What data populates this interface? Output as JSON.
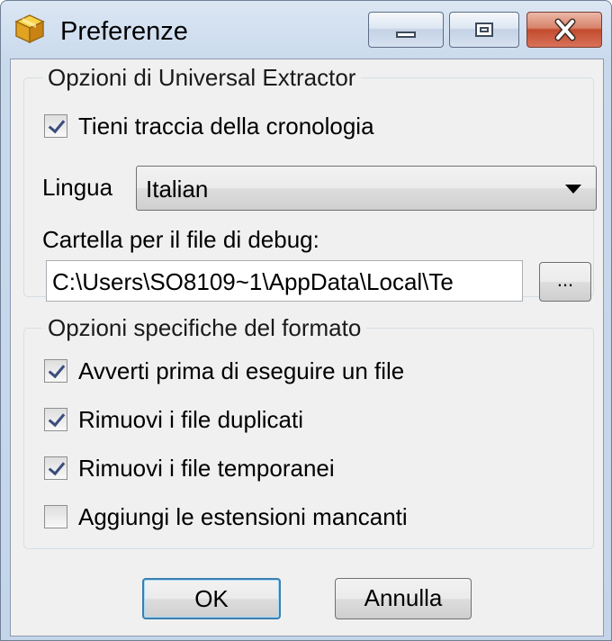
{
  "window": {
    "title": "Preferenze"
  },
  "group_general": {
    "title": "Opzioni di Universal Extractor",
    "history_checkbox": {
      "label": "Tieni traccia della cronologia",
      "checked": true
    },
    "language_label": "Lingua",
    "language_value": "Italian",
    "debug_folder_label": "Cartella per il file di debug:",
    "debug_folder_value": "C:\\Users\\SO8109~1\\AppData\\Local\\Te",
    "browse_label": "..."
  },
  "group_format": {
    "title": "Opzioni specifiche del formato",
    "options": [
      {
        "label": "Avverti prima di eseguire un file",
        "checked": true
      },
      {
        "label": "Rimuovi i file duplicati",
        "checked": true
      },
      {
        "label": "Rimuovi i file temporanei",
        "checked": true
      },
      {
        "label": "Aggiungi le estensioni mancanti",
        "checked": false
      }
    ]
  },
  "buttons": {
    "ok": "OK",
    "cancel": "Annulla"
  }
}
